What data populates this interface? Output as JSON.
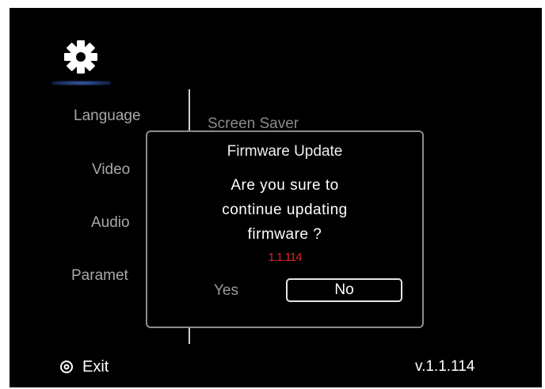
{
  "settings": {
    "icon": "gear-icon",
    "menu": [
      {
        "label": "Language"
      },
      {
        "label": "Video"
      },
      {
        "label": "Audio"
      },
      {
        "label": "Paramet"
      }
    ],
    "submenu_label": "Screen Saver"
  },
  "dialog": {
    "title": "Firmware Update",
    "message_lines": [
      "Are you sure to",
      "continue updating",
      "firmware ?"
    ],
    "version": "1.1.114",
    "yes_label": "Yes",
    "no_label": "No",
    "selected": "No"
  },
  "footer": {
    "exit_icon": "exit-icon",
    "exit_label": "Exit",
    "version": "v.1.1.114"
  },
  "colors": {
    "background": "#000000",
    "version_highlight": "#e0212a"
  }
}
